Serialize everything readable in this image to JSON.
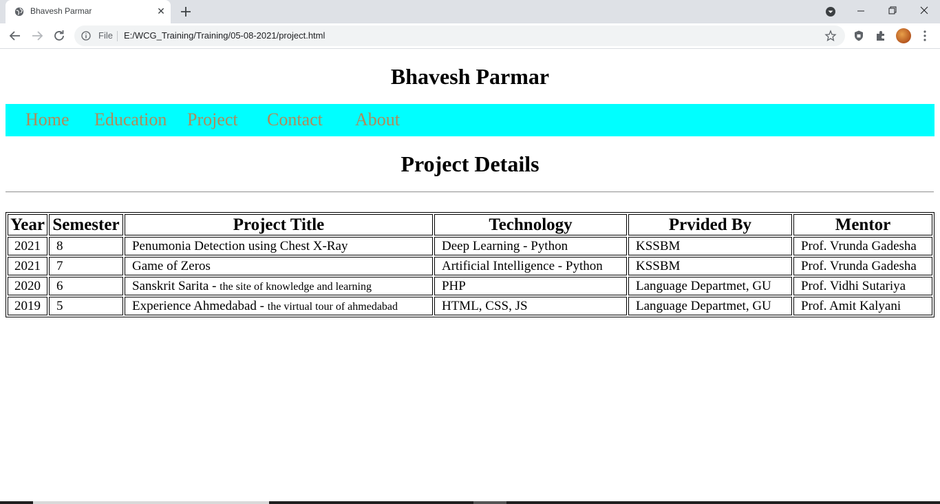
{
  "browser": {
    "tab_title": "Bhavesh Parmar",
    "tab_close": "✕",
    "address": {
      "scheme_label": "File",
      "url": "E:/WCG_Training/Training/05-08-2021/project.html"
    },
    "icons": [
      "globe-icon",
      "close-icon",
      "plus-icon",
      "tab-search-icon",
      "minimize-icon",
      "restore-icon",
      "close-window-icon",
      "back-arrow-icon",
      "forward-arrow-icon",
      "reload-icon",
      "info-icon",
      "star-icon",
      "shield-icon",
      "puzzle-icon",
      "kebab-menu-icon"
    ]
  },
  "page": {
    "site_title": "Bhavesh Parmar",
    "nav": [
      "Home",
      "Education",
      "Project",
      "Contact",
      "About"
    ],
    "section_title": "Project Details",
    "table": {
      "headers": [
        "Year",
        "Semester",
        "Project Title",
        "Technology",
        "Prvided By",
        "Mentor"
      ],
      "rows": [
        {
          "year": "2021",
          "semester": "8",
          "title": "Penumonia Detection using Chest X-Ray",
          "title_note": "",
          "technology": "Deep Learning - Python",
          "provided_by": "KSSBM",
          "mentor": "Prof. Vrunda Gadesha"
        },
        {
          "year": "2021",
          "semester": "7",
          "title": "Game of Zeros",
          "title_note": "",
          "technology": "Artificial Intelligence - Python",
          "provided_by": "KSSBM",
          "mentor": "Prof. Vrunda Gadesha"
        },
        {
          "year": "2020",
          "semester": "6",
          "title": "Sanskrit Sarita - ",
          "title_note": "the site of knowledge and learning",
          "technology": "PHP",
          "provided_by": "Language Departmet, GU",
          "mentor": "Prof. Vidhi Sutariya"
        },
        {
          "year": "2019",
          "semester": "5",
          "title": "Experience Ahmedabad - ",
          "title_note": "the virtual tour of ahmedabad",
          "technology": "HTML, CSS, JS",
          "provided_by": "Language Departmet, GU",
          "mentor": "Prof. Amit Kalyani"
        }
      ]
    }
  },
  "colors": {
    "navbar_bg": "#00ffff",
    "nav_link": "#b08a5a",
    "tabstrip_bg": "#dee1e6"
  }
}
